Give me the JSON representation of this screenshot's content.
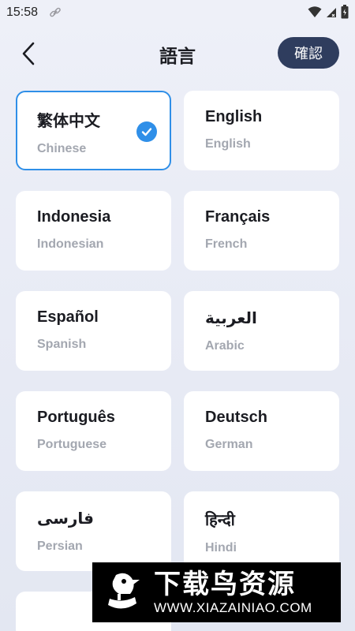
{
  "status_bar": {
    "time": "15:58",
    "icons": [
      "link-icon",
      "wifi-icon",
      "cell-signal-icon",
      "battery-icon"
    ]
  },
  "header": {
    "back_icon": "chevron-left-icon",
    "title": "語言",
    "confirm_label": "確認"
  },
  "languages": [
    {
      "name": "繁体中文",
      "english": "Chinese",
      "selected": true
    },
    {
      "name": "English",
      "english": "English",
      "selected": false
    },
    {
      "name": "Indonesia",
      "english": "Indonesian",
      "selected": false
    },
    {
      "name": "Français",
      "english": "French",
      "selected": false
    },
    {
      "name": "Español",
      "english": "Spanish",
      "selected": false
    },
    {
      "name": "العربية",
      "english": "Arabic",
      "selected": false
    },
    {
      "name": "Português",
      "english": "Portuguese",
      "selected": false
    },
    {
      "name": "Deutsch",
      "english": "German",
      "selected": false
    },
    {
      "name": "فارسی",
      "english": "Persian",
      "selected": false
    },
    {
      "name": "हिन्दी",
      "english": "Hindi",
      "selected": false
    }
  ],
  "watermark": {
    "title": "下载鸟资源",
    "url": "WWW.XIAZAINIAO.COM"
  },
  "colors": {
    "accent": "#2f8fe8",
    "confirm_bg": "#2f3d5e",
    "card_bg": "#ffffff",
    "subtitle": "#a3a7b0"
  }
}
